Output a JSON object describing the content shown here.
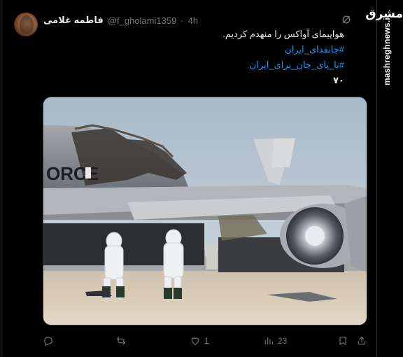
{
  "author": {
    "display_name": "فاطمه غلامی",
    "handle": "@f_gholami1359",
    "separator": "·",
    "time_ago": "4h"
  },
  "tweet": {
    "line1": "هواپیمای آواکس را منهدم کردیم.",
    "hashtag1": "#جانفدای_ایران",
    "hashtag2": "#تا_پای_جان_برای_ایران",
    "count": "۷۰"
  },
  "media": {
    "fuselage_text": "ORCE"
  },
  "actions": {
    "reply_count": "",
    "retweet_count": "",
    "like_count": "1",
    "views_count": "23"
  },
  "watermark": {
    "logo": "مشرق",
    "url": "mashreghnews.ir"
  },
  "colors": {
    "background": "#000000",
    "text": "#e7e9ea",
    "secondary": "#71767b",
    "link": "#1d9bf0",
    "border": "#2f3336"
  },
  "icons": [
    "grok-icon",
    "reply-icon",
    "retweet-icon",
    "like-icon",
    "views-icon",
    "bookmark-icon",
    "share-icon"
  ]
}
